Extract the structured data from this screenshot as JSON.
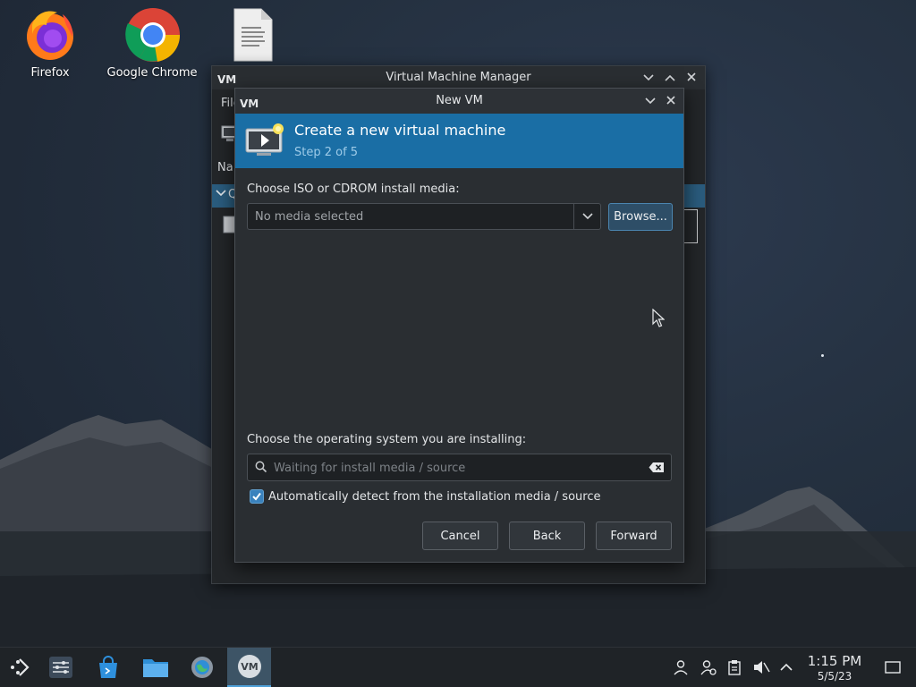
{
  "desktop": {
    "icons": [
      {
        "label": "Firefox"
      },
      {
        "label": "Google Chrome"
      },
      {
        "label": ""
      }
    ]
  },
  "back_window": {
    "title": "Virtual Machine Manager",
    "logo_text": "VM",
    "menu_fragment": "File",
    "name_fragment": "Na",
    "row_fragment": "Q"
  },
  "dialog": {
    "title": "New VM",
    "logo_text": "VM",
    "header": "Create a new virtual machine",
    "step": "Step 2 of 5",
    "iso_label": "Choose ISO or CDROM install media:",
    "media_placeholder": "No media selected",
    "browse_label": "Browse...",
    "os_label": "Choose the operating system you are installing:",
    "os_search_placeholder": "Waiting for install media / source",
    "auto_detect_label": "Automatically detect from the installation media / source",
    "auto_detect_checked": true,
    "cancel_label": "Cancel",
    "back_label": "Back",
    "forward_label": "Forward"
  },
  "taskbar": {
    "vm_logo_text": "VM",
    "time": "1:15 PM",
    "date": "5/5/23"
  },
  "colors": {
    "accent": "#1a6ea5",
    "step_text": "#9ecbe8",
    "checkbox": "#3a82bd"
  }
}
